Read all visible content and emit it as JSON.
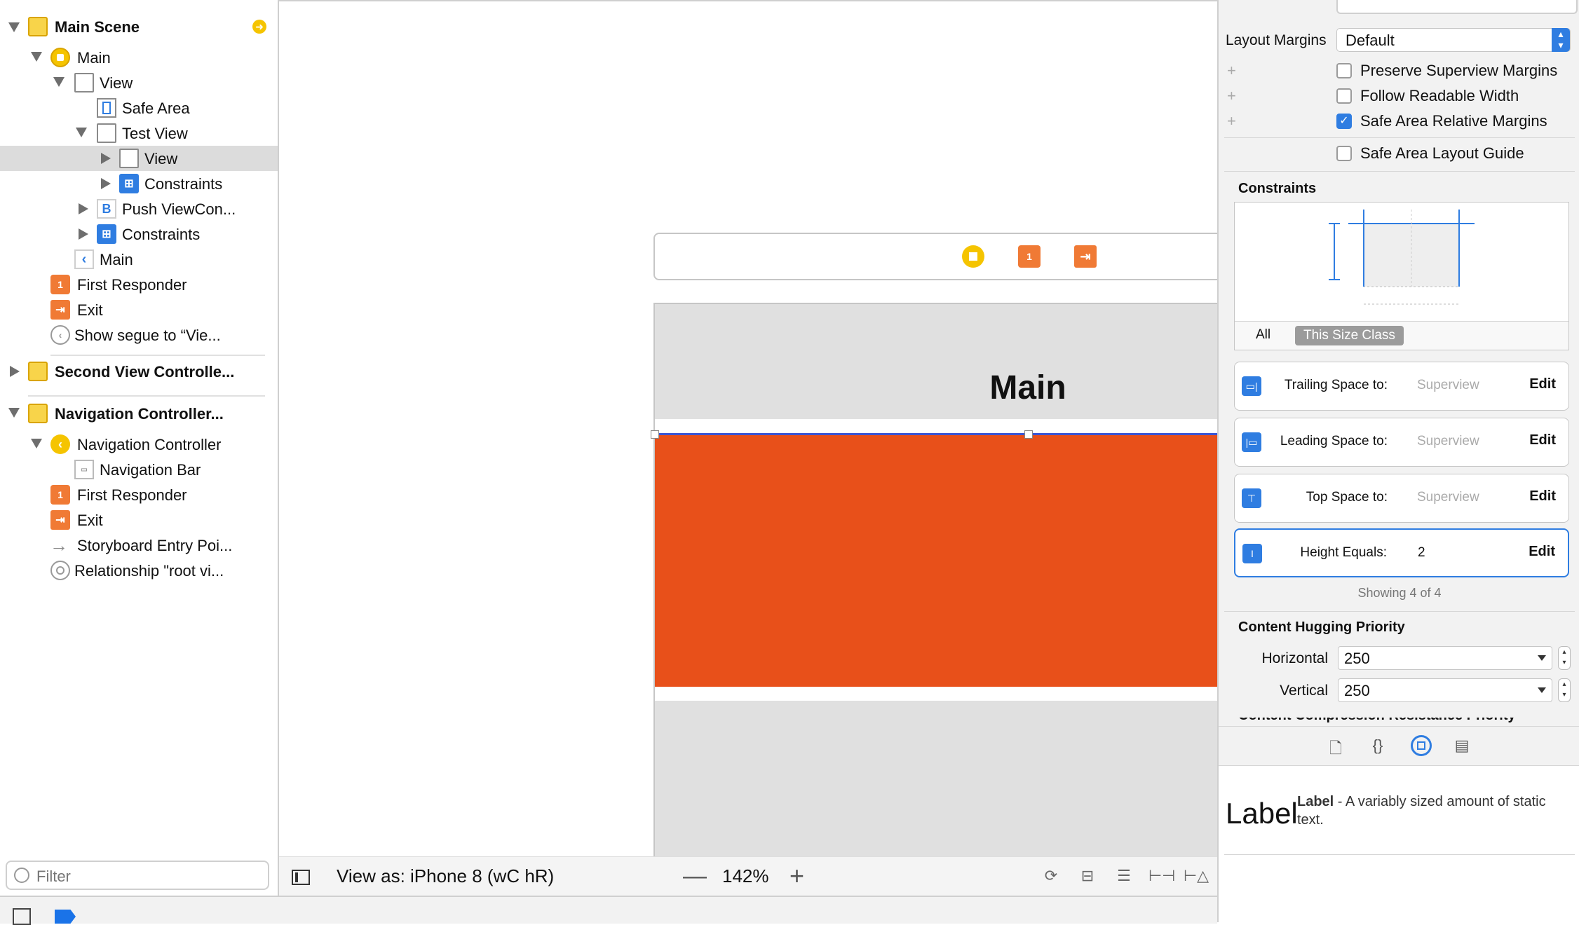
{
  "outline": {
    "rows": [
      {
        "label": "Main Scene"
      },
      {
        "label": "Main"
      },
      {
        "label": "View"
      },
      {
        "label": "Safe Area"
      },
      {
        "label": "Test View"
      },
      {
        "label": "View"
      },
      {
        "label": "Constraints"
      },
      {
        "label": "Push ViewCon..."
      },
      {
        "label": "Constraints"
      },
      {
        "label": "Main"
      },
      {
        "label": "First Responder"
      },
      {
        "label": "Exit"
      },
      {
        "label": "Show segue to “Vie..."
      },
      {
        "label": "Second View Controlle..."
      },
      {
        "label": "Navigation Controller..."
      },
      {
        "label": "Navigation Controller"
      },
      {
        "label": "Navigation Bar"
      },
      {
        "label": "First Responder"
      },
      {
        "label": "Exit"
      },
      {
        "label": "Storyboard Entry Poi..."
      },
      {
        "label": "Relationship \"root vi..."
      }
    ],
    "filter_placeholder": "Filter"
  },
  "canvas": {
    "nav_title": "Main",
    "view_as": "View as: iPhone 8 (wC hR)",
    "zoom": "142%",
    "zoom_out": "—",
    "zoom_in": "+",
    "selected_view_color": "#e8501a"
  },
  "inspector": {
    "layout_margins_label": "Layout Margins",
    "layout_margins_value": "Default",
    "checkboxes": [
      {
        "label": "Preserve Superview Margins",
        "checked": false
      },
      {
        "label": "Follow Readable Width",
        "checked": false
      },
      {
        "label": "Safe Area Relative Margins",
        "checked": true
      },
      {
        "label": "Safe Area Layout Guide",
        "checked": false
      }
    ],
    "constraints_title": "Constraints",
    "tab_all": "All",
    "tab_size_class": "This Size Class",
    "constraints": [
      {
        "label": "Trailing Space to:",
        "value": "Superview",
        "edit": "Edit"
      },
      {
        "label": "Leading Space to:",
        "value": "Superview",
        "edit": "Edit"
      },
      {
        "label": "Top Space to:",
        "value": "Superview",
        "edit": "Edit"
      },
      {
        "label": "Height Equals:",
        "value": "2",
        "edit": "Edit"
      }
    ],
    "showing": "Showing 4 of 4",
    "hugging_title": "Content Hugging Priority",
    "horizontal_label": "Horizontal",
    "horizontal_value": "250",
    "vertical_label": "Vertical",
    "vertical_value": "250",
    "compression_title": "Content Compression Resistance Priority"
  },
  "library": {
    "preview": "Label",
    "name": "Label",
    "description": " - A variably sized amount of static text."
  }
}
